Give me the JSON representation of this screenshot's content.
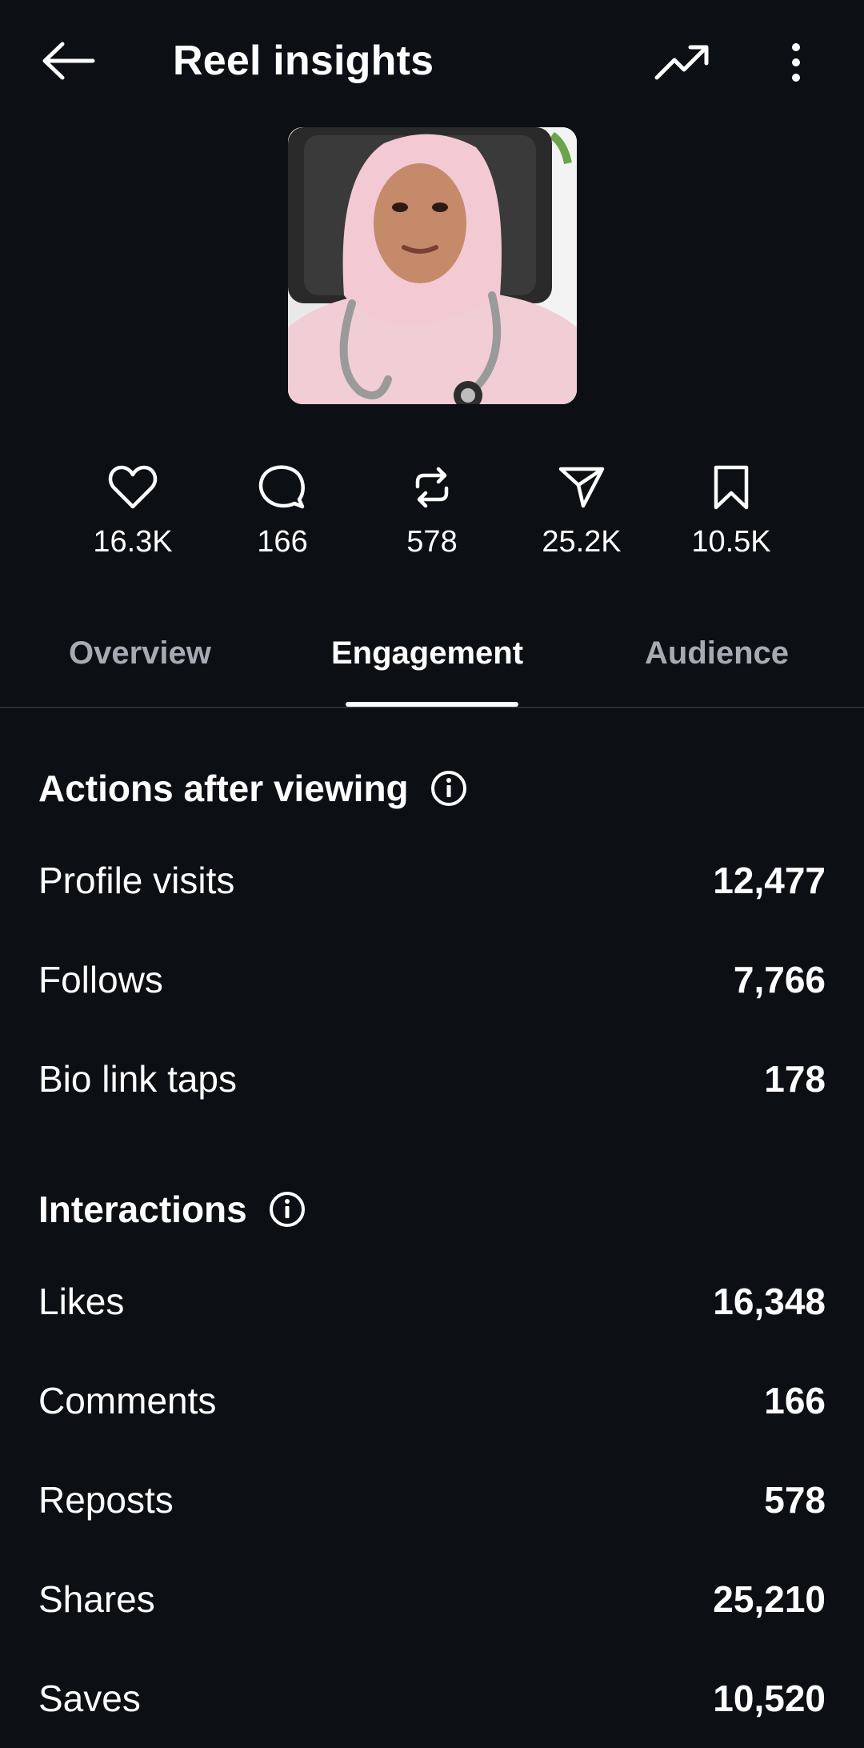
{
  "header": {
    "title": "Reel insights"
  },
  "icons": {
    "back": "arrow-left-icon",
    "trend": "trending-up-icon",
    "more": "more-vertical-icon"
  },
  "stats": [
    {
      "icon": "heart-icon",
      "value": "16.3K"
    },
    {
      "icon": "comment-icon",
      "value": "166"
    },
    {
      "icon": "repost-icon",
      "value": "578"
    },
    {
      "icon": "send-icon",
      "value": "25.2K"
    },
    {
      "icon": "bookmark-icon",
      "value": "10.5K"
    }
  ],
  "tabs": [
    {
      "label": "Overview",
      "active": false
    },
    {
      "label": "Engagement",
      "active": true
    },
    {
      "label": "Audience",
      "active": false
    }
  ],
  "actions_section": {
    "title": "Actions after viewing",
    "rows": [
      {
        "label": "Profile visits",
        "value": "12,477"
      },
      {
        "label": "Follows",
        "value": "7,766"
      },
      {
        "label": "Bio link taps",
        "value": "178"
      }
    ]
  },
  "interactions_section": {
    "title": "Interactions",
    "rows": [
      {
        "label": "Likes",
        "value": "16,348"
      },
      {
        "label": "Comments",
        "value": "166"
      },
      {
        "label": "Reposts",
        "value": "578"
      },
      {
        "label": "Shares",
        "value": "25,210"
      },
      {
        "label": "Saves",
        "value": "10,520"
      }
    ]
  },
  "colors": {
    "background": "#0c0f14",
    "text": "#ffffff",
    "muted_tab": "#a6abb3",
    "divider": "#2b3038"
  }
}
